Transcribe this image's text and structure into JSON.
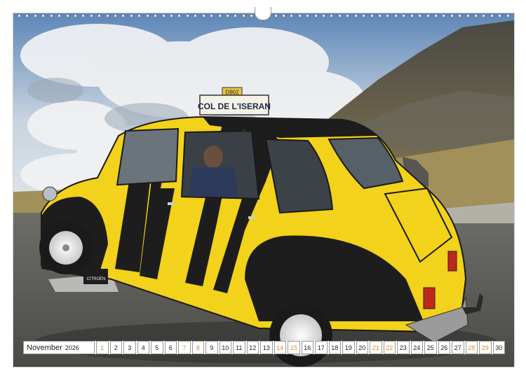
{
  "sign": {
    "route_number": "D902",
    "pass_name": "COL DE L'ISERAN"
  },
  "calendar": {
    "month": "November",
    "year": "2026",
    "days": [
      {
        "d": "1",
        "weekend": true
      },
      {
        "d": "2",
        "weekend": false
      },
      {
        "d": "3",
        "weekend": false
      },
      {
        "d": "4",
        "weekend": false
      },
      {
        "d": "5",
        "weekend": false
      },
      {
        "d": "6",
        "weekend": false
      },
      {
        "d": "7",
        "weekend": true
      },
      {
        "d": "8",
        "weekend": true
      },
      {
        "d": "9",
        "weekend": false
      },
      {
        "d": "10",
        "weekend": false
      },
      {
        "d": "11",
        "weekend": false
      },
      {
        "d": "12",
        "weekend": false
      },
      {
        "d": "13",
        "weekend": false
      },
      {
        "d": "14",
        "weekend": true
      },
      {
        "d": "15",
        "weekend": true
      },
      {
        "d": "16",
        "weekend": false
      },
      {
        "d": "17",
        "weekend": false
      },
      {
        "d": "18",
        "weekend": false
      },
      {
        "d": "19",
        "weekend": false
      },
      {
        "d": "20",
        "weekend": false
      },
      {
        "d": "21",
        "weekend": true
      },
      {
        "d": "22",
        "weekend": true
      },
      {
        "d": "23",
        "weekend": false
      },
      {
        "d": "24",
        "weekend": false
      },
      {
        "d": "25",
        "weekend": false
      },
      {
        "d": "26",
        "weekend": false
      },
      {
        "d": "27",
        "weekend": false
      },
      {
        "d": "28",
        "weekend": true
      },
      {
        "d": "29",
        "weekend": true
      },
      {
        "d": "30",
        "weekend": false
      }
    ]
  },
  "colors": {
    "car_yellow": "#f2d21a",
    "car_black": "#1d1d1d",
    "weekend": "#e08a2e"
  },
  "badge_text": "CITROËN"
}
